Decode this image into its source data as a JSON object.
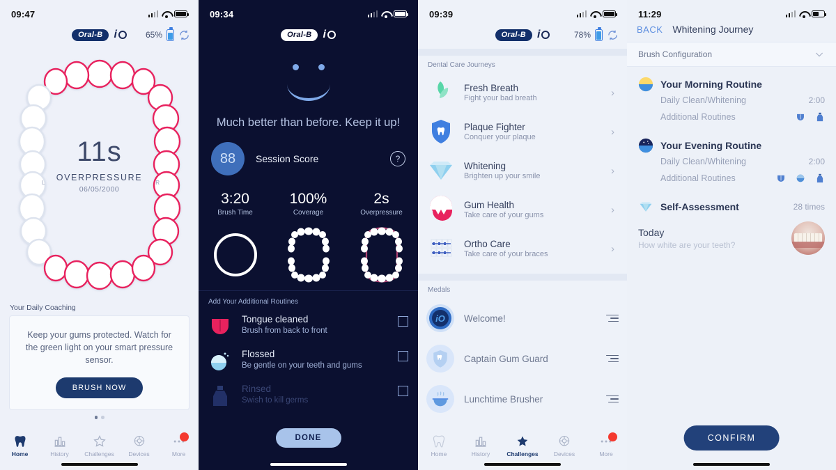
{
  "panel1": {
    "status": {
      "time": "09:47",
      "signal_icon": "signal-bars-icon",
      "wifi_icon": "wifi-icon",
      "battery_icon": "battery-icon"
    },
    "brand": {
      "logo": "Oral-B",
      "io": "iO",
      "battery_percent": "65%",
      "sync_icon": "sync-icon"
    },
    "teeth": {
      "seconds": "11s",
      "label": "OVERPRESSURE",
      "date": "06/05/2000",
      "left_marker": "L",
      "right_marker": "R"
    },
    "coaching": {
      "section_label": "Your Daily Coaching",
      "text": "Keep your gums protected. Watch for the green light on your smart pressure sensor.",
      "cta": "BRUSH NOW",
      "dots": 2,
      "active_dot": 0
    },
    "tabs": [
      {
        "label": "Home",
        "icon": "tooth-icon",
        "active": true
      },
      {
        "label": "History",
        "icon": "bar-chart-icon",
        "active": false
      },
      {
        "label": "Challenges",
        "icon": "star-icon",
        "active": false
      },
      {
        "label": "Devices",
        "icon": "brush-head-icon",
        "active": false
      },
      {
        "label": "More",
        "icon": "more-dots-icon",
        "active": false
      }
    ]
  },
  "panel2": {
    "status": {
      "time": "09:34"
    },
    "brand": {
      "logo": "Oral-B",
      "io": "iO"
    },
    "smiley": {
      "face_icon": "smiley-face-icon"
    },
    "encouragement": "Much better than before. Keep it up!",
    "score": {
      "value": "88",
      "label": "Session Score",
      "help_icon": "help-circle-icon"
    },
    "stats": [
      {
        "value": "3:20",
        "label": "Brush Time",
        "gfx": "ring-icon"
      },
      {
        "value": "100%",
        "label": "Coverage",
        "gfx": "teeth-coverage-icon"
      },
      {
        "value": "2s",
        "label": "Overpressure",
        "gfx": "teeth-overpressure-icon"
      }
    ],
    "routines_header": "Add Your Additional Routines",
    "routines": [
      {
        "title": "Tongue cleaned",
        "sub": "Brush from back to front",
        "icon": "tongue-icon",
        "checked": false,
        "faded": false
      },
      {
        "title": "Flossed",
        "sub": "Be gentle on your teeth and gums",
        "icon": "floss-icon",
        "checked": false,
        "faded": false
      },
      {
        "title": "Rinsed",
        "sub": "Swish to kill germs",
        "icon": "mouthwash-icon",
        "checked": false,
        "faded": true
      }
    ],
    "done_label": "DONE"
  },
  "panel3": {
    "status": {
      "time": "09:39"
    },
    "brand": {
      "logo": "Oral-B",
      "io": "iO",
      "battery_percent": "78%",
      "sync_icon": "sync-icon"
    },
    "journeys_header": "Dental Care Journeys",
    "journeys": [
      {
        "title": "Fresh Breath",
        "sub": "Fight your bad breath",
        "icon": "leaves-icon"
      },
      {
        "title": "Plaque Fighter",
        "sub": "Conquer your plaque",
        "icon": "shield-tooth-icon"
      },
      {
        "title": "Whitening",
        "sub": "Brighten up your smile",
        "icon": "diamond-icon"
      },
      {
        "title": "Gum Health",
        "sub": "Take care of your gums",
        "icon": "gums-icon"
      },
      {
        "title": "Ortho Care",
        "sub": "Take care of your braces",
        "icon": "braces-icon"
      }
    ],
    "medals_header": "Medals",
    "medals": [
      {
        "title": "Welcome!",
        "icon": "io-badge-icon"
      },
      {
        "title": "Captain Gum Guard",
        "icon": "shield-tooth-badge-icon"
      },
      {
        "title": "Lunchtime Brusher",
        "icon": "meal-bowl-icon"
      }
    ],
    "tabs": [
      {
        "label": "Home",
        "icon": "tooth-icon",
        "active": false
      },
      {
        "label": "History",
        "icon": "bar-chart-icon",
        "active": false
      },
      {
        "label": "Challenges",
        "icon": "star-icon",
        "active": true
      },
      {
        "label": "Devices",
        "icon": "brush-head-icon",
        "active": false
      },
      {
        "label": "More",
        "icon": "more-dots-icon",
        "active": false
      }
    ]
  },
  "panel4": {
    "status": {
      "time": "11:29"
    },
    "nav": {
      "back": "BACK",
      "title": "Whitening Journey"
    },
    "config": {
      "label": "Brush Configuration",
      "chevron": "chevron-down-icon"
    },
    "morning": {
      "title": "Your Morning Routine",
      "icon": "sunrise-icon",
      "clean_label": "Daily Clean/Whitening",
      "clean_time": "2:00",
      "additional_label": "Additional Routines",
      "additional_icons": [
        "tongue-icon",
        "mouthwash-icon"
      ]
    },
    "evening": {
      "title": "Your Evening Routine",
      "icon": "moon-icon",
      "clean_label": "Daily Clean/Whitening",
      "clean_time": "2:00",
      "additional_label": "Additional Routines",
      "additional_icons": [
        "tongue-icon",
        "floss-icon",
        "mouthwash-icon"
      ]
    },
    "assessment": {
      "title": "Self-Assessment",
      "icon": "diamond-icon",
      "count": "28 times",
      "today_title": "Today",
      "today_sub": "How white are your teeth?",
      "photo": "teeth-photo"
    },
    "confirm_label": "CONFIRM"
  }
}
